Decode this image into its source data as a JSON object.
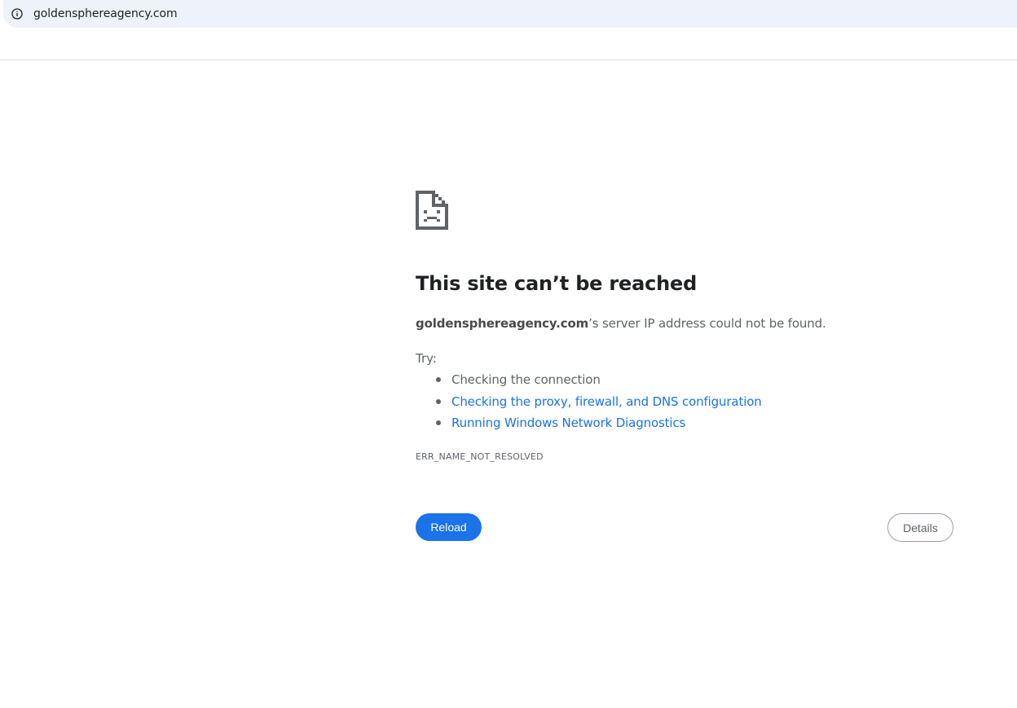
{
  "address_bar": {
    "url": "goldensphereagency.com",
    "icon": "info-icon"
  },
  "error_page": {
    "icon": "sad-page-icon",
    "title": "This site can’t be reached",
    "host": "goldensphereagency.com",
    "message_suffix": "’s server IP address could not be found.",
    "try_label": "Try:",
    "suggestions": [
      {
        "label": "Checking the connection",
        "is_link": false
      },
      {
        "label": "Checking the proxy, firewall, and DNS configuration",
        "is_link": true
      },
      {
        "label": "Running Windows Network Diagnostics",
        "is_link": true
      }
    ],
    "error_code": "ERR_NAME_NOT_RESOLVED",
    "reload_label": "Reload",
    "details_label": "Details"
  },
  "colors": {
    "accent": "#1a73e8",
    "text_primary": "#202124",
    "text_secondary": "#5f6368",
    "omnibox_bg": "#eef2fa"
  }
}
